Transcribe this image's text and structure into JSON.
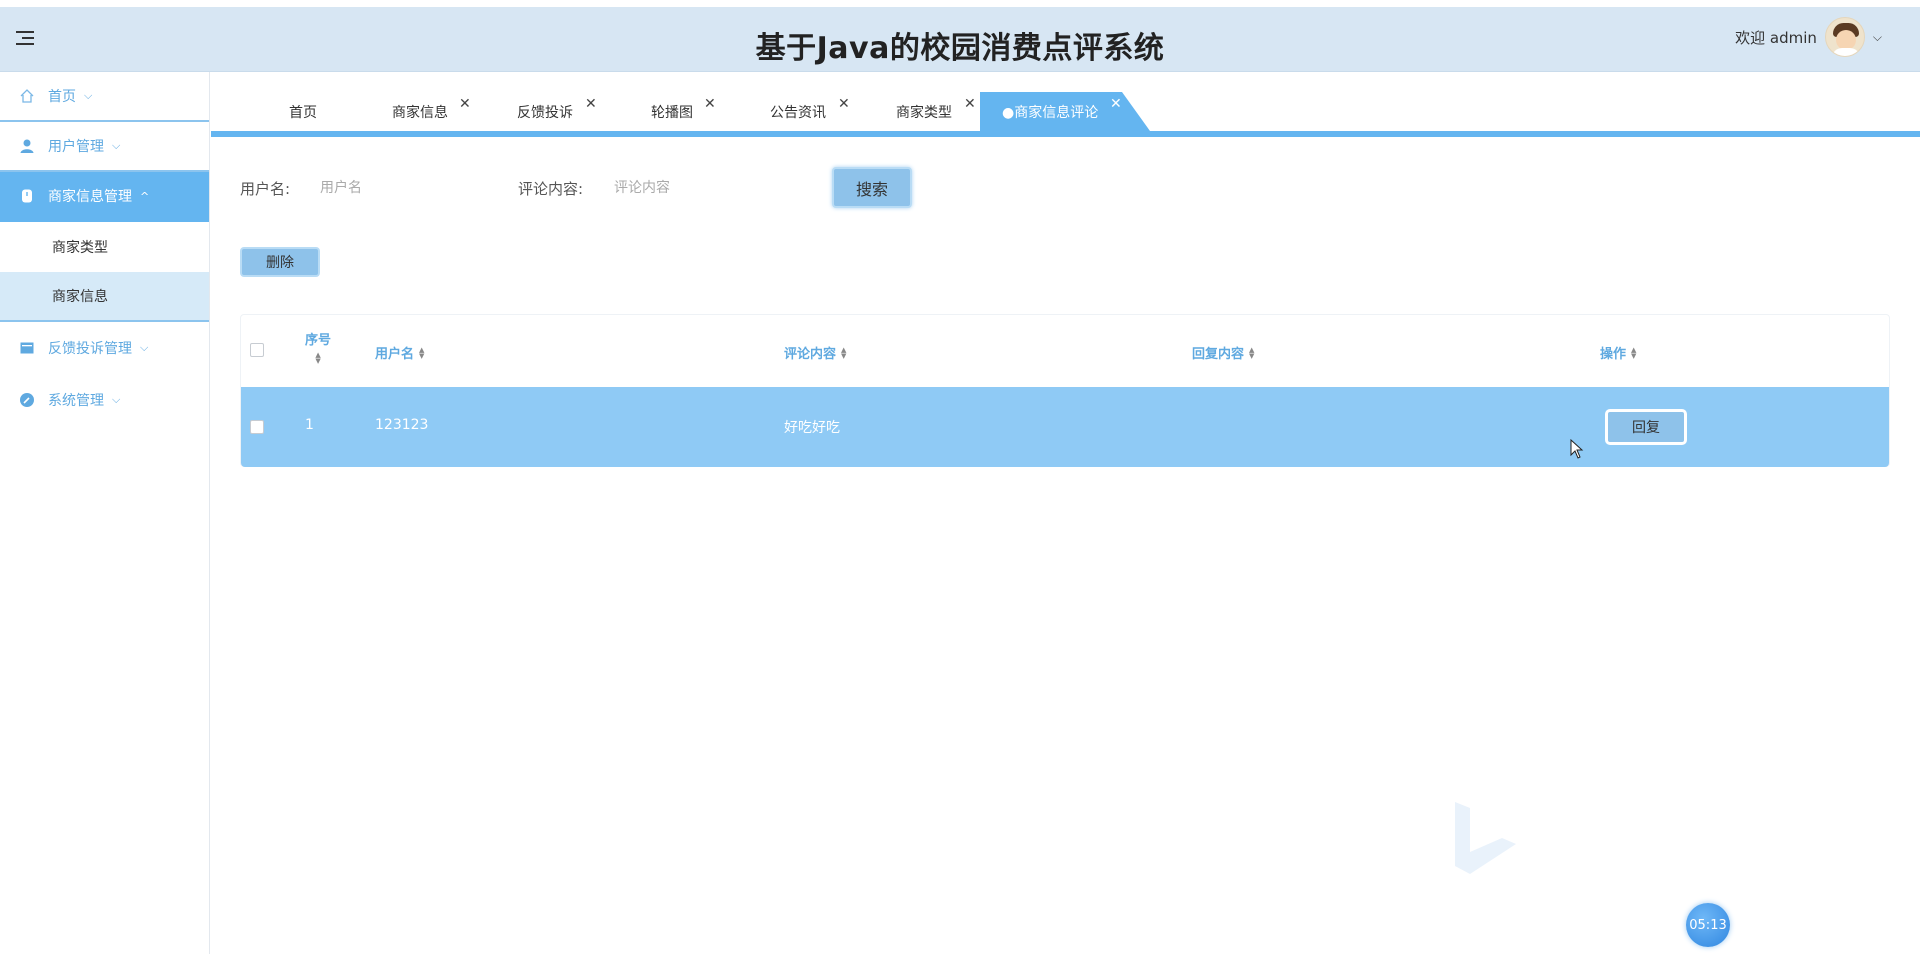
{
  "header": {
    "title": "基于Java的校园消费点评系统",
    "welcome": "欢迎 admin"
  },
  "sidebar": {
    "items": [
      {
        "label": "首页",
        "icon": "home-icon"
      },
      {
        "label": "用户管理",
        "icon": "user-icon"
      },
      {
        "label": "商家信息管理",
        "icon": "store-icon",
        "expanded": true,
        "children": [
          {
            "label": "商家类型"
          },
          {
            "label": "商家信息"
          }
        ]
      },
      {
        "label": "反馈投诉管理",
        "icon": "feedback-icon"
      },
      {
        "label": "系统管理",
        "icon": "settings-icon"
      }
    ]
  },
  "tabs": [
    {
      "label": "首页",
      "closable": false
    },
    {
      "label": "商家信息",
      "closable": true
    },
    {
      "label": "反馈投诉",
      "closable": true
    },
    {
      "label": "轮播图",
      "closable": true
    },
    {
      "label": "公告资讯",
      "closable": true
    },
    {
      "label": "商家类型",
      "closable": true
    },
    {
      "label": "●商家信息评论",
      "closable": true,
      "active": true
    }
  ],
  "search": {
    "username_label": "用户名:",
    "username_placeholder": "用户名",
    "comment_label": "评论内容:",
    "comment_placeholder": "评论内容",
    "search_button": "搜索"
  },
  "actions": {
    "delete_button": "删除"
  },
  "table": {
    "columns": [
      "序号",
      "用户名",
      "评论内容",
      "回复内容",
      "操作"
    ],
    "rows": [
      {
        "index": "1",
        "username": "123123",
        "comment": "好吃好吃",
        "reply": "",
        "action": "回复"
      }
    ]
  },
  "clock": "05:13",
  "colors": {
    "accent": "#64b5f0",
    "header_bg": "#d7e6f3",
    "row_highlight": "#8fcaf5"
  }
}
